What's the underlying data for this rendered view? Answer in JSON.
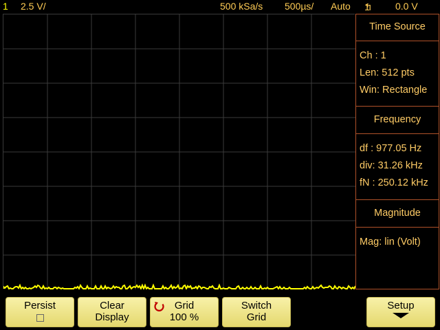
{
  "status": {
    "channel": "1",
    "volts_per_div": "2.5 V/",
    "sample_rate": "500 kSa/s",
    "timebase": "500µs/",
    "trigger_mode": "Auto",
    "trigger_source": "1",
    "trigger_level": "0.0 V"
  },
  "panel": {
    "time_source_title": "Time Source",
    "channel": "Ch :  1",
    "length": "Len:  512  pts",
    "window": "Win: Rectangle",
    "frequency_title": "Frequency",
    "df": "df : 977.05  Hz",
    "div": "div:  31.26 kHz",
    "fn": "fN : 250.12 kHz",
    "magnitude_title": "Magnitude",
    "mag": "Mag: lin (Volt)"
  },
  "softkeys": {
    "persist": "Persist",
    "clear_1": "Clear",
    "clear_2": "Display",
    "grid_1": "Grid",
    "grid_2": "100 %",
    "switch_1": "Switch",
    "switch_2": "Grid",
    "setup": "Setup"
  },
  "colors": {
    "trace": "#ffff00",
    "grid": "#3a3a3a",
    "panel_border": "#b0522a",
    "text": "#ffcc66"
  }
}
